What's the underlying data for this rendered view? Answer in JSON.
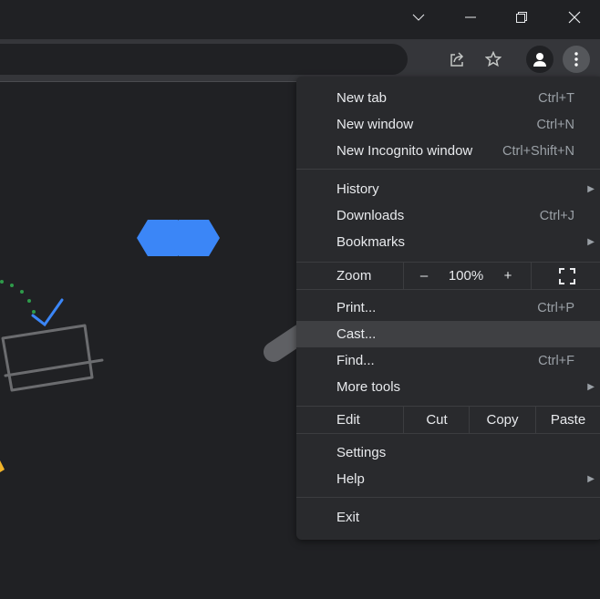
{
  "window": {
    "controls": [
      "chevron-down",
      "minimize",
      "restore",
      "close"
    ]
  },
  "toolbar": {
    "icons": [
      "share-icon",
      "star-icon",
      "profile-icon",
      "more-vert-icon"
    ]
  },
  "menu": {
    "new_tab": {
      "label": "New tab",
      "shortcut": "Ctrl+T"
    },
    "new_window": {
      "label": "New window",
      "shortcut": "Ctrl+N"
    },
    "incognito": {
      "label": "New Incognito window",
      "shortcut": "Ctrl+Shift+N"
    },
    "history": {
      "label": "History"
    },
    "downloads": {
      "label": "Downloads",
      "shortcut": "Ctrl+J"
    },
    "bookmarks": {
      "label": "Bookmarks"
    },
    "zoom": {
      "label": "Zoom",
      "minus": "–",
      "value": "100%",
      "plus": "+"
    },
    "print": {
      "label": "Print...",
      "shortcut": "Ctrl+P"
    },
    "cast": {
      "label": "Cast..."
    },
    "find": {
      "label": "Find...",
      "shortcut": "Ctrl+F"
    },
    "more_tools": {
      "label": "More tools"
    },
    "edit": {
      "label": "Edit",
      "cut": "Cut",
      "copy": "Copy",
      "paste": "Paste"
    },
    "settings": {
      "label": "Settings"
    },
    "help": {
      "label": "Help"
    },
    "exit": {
      "label": "Exit"
    }
  },
  "colors": {
    "accent": "#3b82f6",
    "highlight": "#3f4043",
    "menu_bg": "#292a2d"
  }
}
